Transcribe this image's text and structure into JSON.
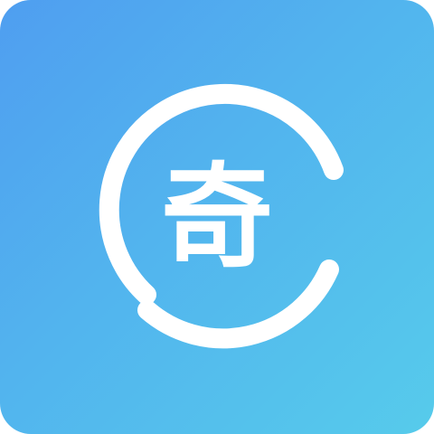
{
  "app_icon": {
    "glyph": "奇",
    "colors": {
      "gradient_start": "#4f9ef0",
      "gradient_mid": "#52b4ee",
      "gradient_end": "#56cbeb",
      "ring": "#ffffff",
      "glyph": "#ffffff"
    },
    "ring_icon": "open-circle-ring-icon"
  }
}
